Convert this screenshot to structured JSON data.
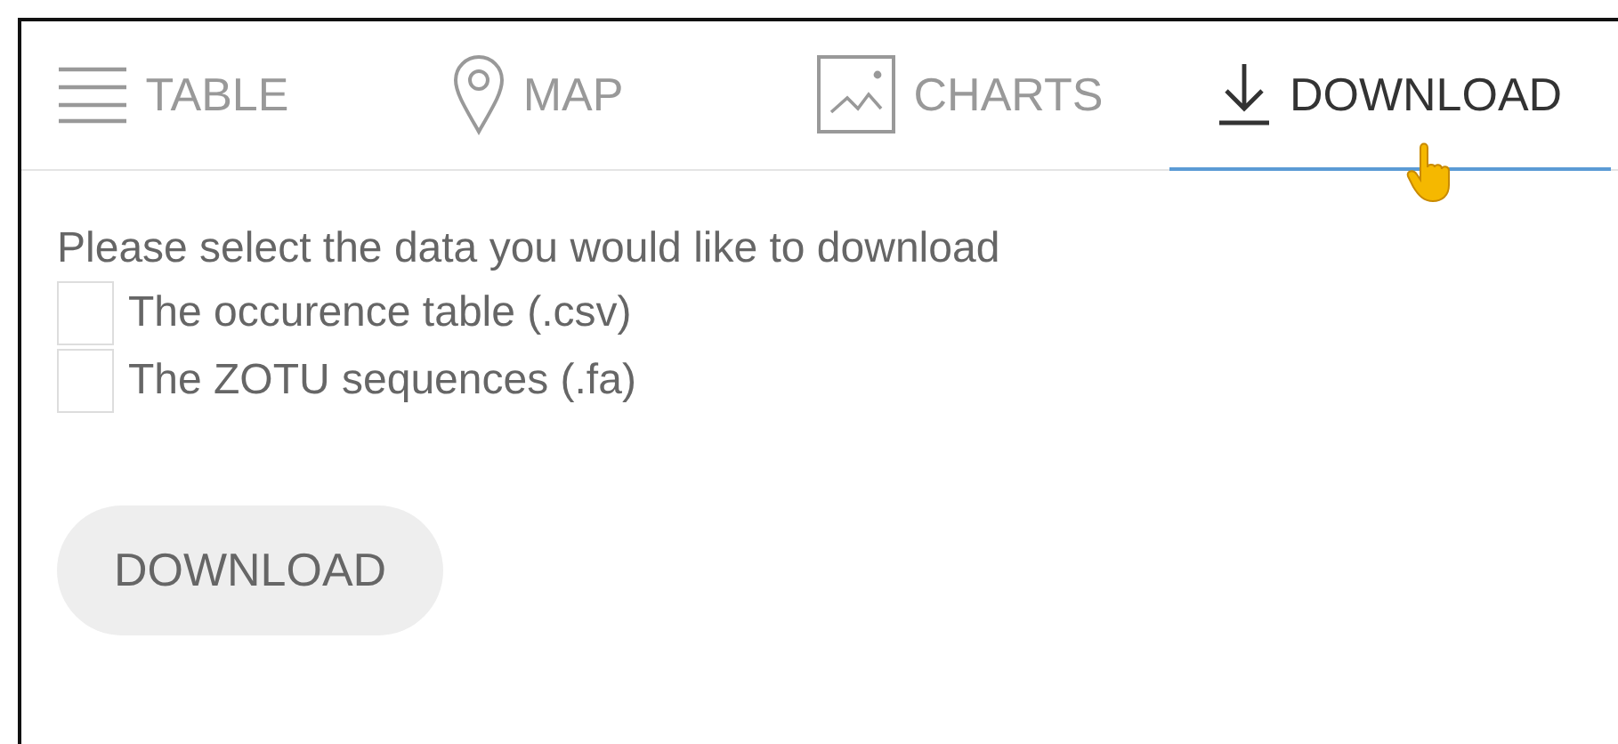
{
  "tabs": [
    {
      "label": "TABLE",
      "kind": "table",
      "selected": false
    },
    {
      "label": "MAP",
      "kind": "map",
      "selected": false
    },
    {
      "label": "CHARTS",
      "kind": "charts",
      "selected": false
    },
    {
      "label": "DOWNLOAD",
      "kind": "download",
      "selected": true
    }
  ],
  "prompt": "Please select the data you would like to download",
  "options": [
    {
      "label": "The occurence table (.csv)",
      "checked": false
    },
    {
      "label": "The ZOTU sequences (.fa)",
      "checked": false
    }
  ],
  "button": "DOWNLOAD"
}
